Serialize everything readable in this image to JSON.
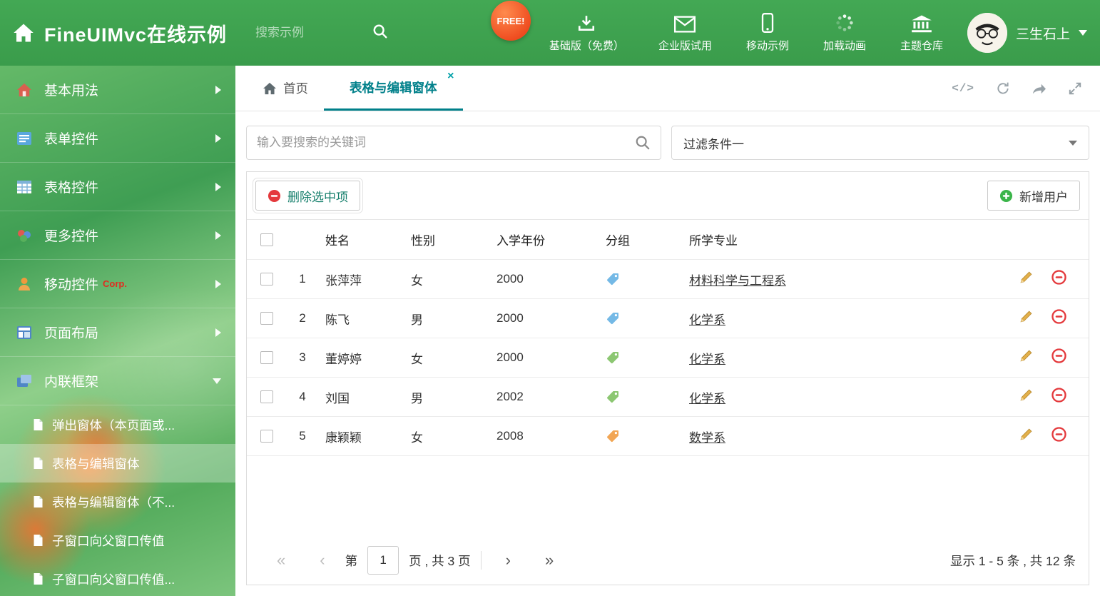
{
  "header": {
    "app_title": "FineUIMvc在线示例",
    "search_placeholder": "搜索示例",
    "free_badge": "FREE!",
    "nav_items": [
      {
        "label": "基础版（免费）",
        "icon": "download-icon"
      },
      {
        "label": "企业版试用",
        "icon": "envelope-icon"
      },
      {
        "label": "移动示例",
        "icon": "mobile-icon"
      },
      {
        "label": "加载动画",
        "icon": "spinner-icon"
      },
      {
        "label": "主题仓库",
        "icon": "bank-icon"
      }
    ],
    "user_name": "三生石上"
  },
  "sidebar": {
    "items": [
      {
        "label": "基本用法"
      },
      {
        "label": "表单控件"
      },
      {
        "label": "表格控件"
      },
      {
        "label": "更多控件"
      },
      {
        "label": "移动控件",
        "badge": "Corp."
      },
      {
        "label": "页面布局"
      },
      {
        "label": "内联框架"
      }
    ],
    "subitems": [
      {
        "label": "弹出窗体（本页面或..."
      },
      {
        "label": "表格与编辑窗体"
      },
      {
        "label": "表格与编辑窗体（不..."
      },
      {
        "label": "子窗口向父窗口传值"
      },
      {
        "label": "子窗口向父窗口传值..."
      }
    ]
  },
  "tabs": {
    "home_label": "首页",
    "active_label": "表格与编辑窗体",
    "close_glyph": "×"
  },
  "filter": {
    "search_placeholder": "输入要搜索的关键词",
    "dropdown_value": "过滤条件一"
  },
  "toolbar": {
    "delete_label": "删除选中项",
    "add_label": "新增用户"
  },
  "table": {
    "columns": {
      "name": "姓名",
      "gender": "性别",
      "year": "入学年份",
      "group": "分组",
      "major": "所学专业"
    },
    "rows": [
      {
        "idx": "1",
        "name": "张萍萍",
        "gender": "女",
        "year": "2000",
        "tag_color": "#74b9e6",
        "major": "材料科学与工程系"
      },
      {
        "idx": "2",
        "name": "陈飞",
        "gender": "男",
        "year": "2000",
        "tag_color": "#74b9e6",
        "major": "化学系"
      },
      {
        "idx": "3",
        "name": "董婷婷",
        "gender": "女",
        "year": "2000",
        "tag_color": "#8cc772",
        "major": "化学系"
      },
      {
        "idx": "4",
        "name": "刘国",
        "gender": "男",
        "year": "2002",
        "tag_color": "#8cc772",
        "major": "化学系"
      },
      {
        "idx": "5",
        "name": "康颖颖",
        "gender": "女",
        "year": "2008",
        "tag_color": "#f2a654",
        "major": "数学系"
      }
    ]
  },
  "pagination": {
    "first": "«",
    "prev": "‹",
    "page_prefix": "第",
    "current_page": "1",
    "page_suffix": "页 , 共 3 页",
    "next": "›",
    "last": "»",
    "summary": "显示 1 - 5 条 , 共 12 条"
  },
  "colors": {
    "header_green": "#3fa34f",
    "active_tab_teal": "#00808a",
    "delete_red": "#e4393c",
    "add_green": "#3bb54a",
    "pencil_gold": "#e3b04b",
    "free_badge_orange": "#ee4a1e"
  }
}
